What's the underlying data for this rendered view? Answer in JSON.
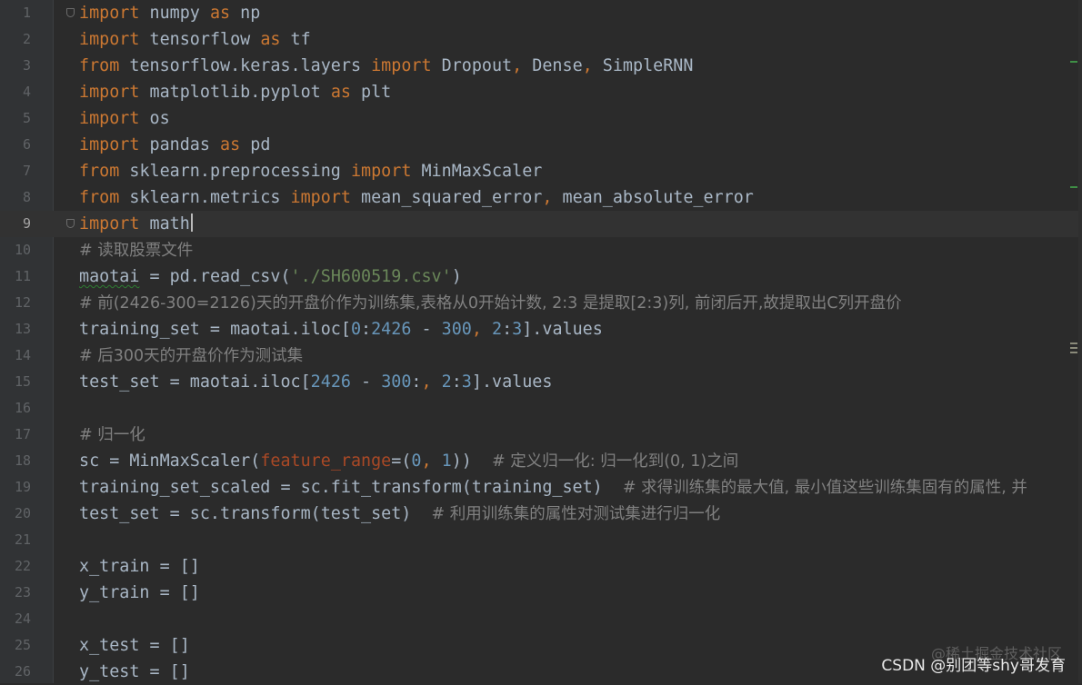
{
  "editor": {
    "language": "python",
    "current_line": 9,
    "theme_colors": {
      "background": "#2b2b2b",
      "gutter": "#313335",
      "keyword": "#cc7832",
      "comment": "#808080",
      "string": "#6a8759",
      "number": "#6897bb",
      "text": "#a9b7c6",
      "param": "#aa4926"
    },
    "lines": [
      {
        "n": "1",
        "t": [
          [
            "kw",
            "import"
          ],
          [
            "",
            " numpy "
          ],
          [
            "kw",
            "as"
          ],
          [
            "",
            " np"
          ]
        ]
      },
      {
        "n": "2",
        "t": [
          [
            "kw",
            "import"
          ],
          [
            "",
            " tensorflow "
          ],
          [
            "kw",
            "as"
          ],
          [
            "",
            " tf"
          ]
        ]
      },
      {
        "n": "3",
        "t": [
          [
            "kw",
            "from"
          ],
          [
            "",
            " tensorflow.keras.layers "
          ],
          [
            "kw",
            "import"
          ],
          [
            "",
            " Dropout"
          ],
          [
            "kw",
            ","
          ],
          [
            "",
            " Dense"
          ],
          [
            "kw",
            ","
          ],
          [
            "",
            " SimpleRNN"
          ]
        ]
      },
      {
        "n": "4",
        "t": [
          [
            "kw",
            "import"
          ],
          [
            "",
            " matplotlib.pyplot "
          ],
          [
            "kw",
            "as"
          ],
          [
            "",
            " plt"
          ]
        ]
      },
      {
        "n": "5",
        "t": [
          [
            "kw",
            "import"
          ],
          [
            "",
            " os"
          ]
        ]
      },
      {
        "n": "6",
        "t": [
          [
            "kw",
            "import"
          ],
          [
            "",
            " pandas "
          ],
          [
            "kw",
            "as"
          ],
          [
            "",
            " pd"
          ]
        ]
      },
      {
        "n": "7",
        "t": [
          [
            "kw",
            "from"
          ],
          [
            "",
            " sklearn.preprocessing "
          ],
          [
            "kw",
            "import"
          ],
          [
            "",
            " MinMaxScaler"
          ]
        ]
      },
      {
        "n": "8",
        "t": [
          [
            "kw",
            "from"
          ],
          [
            "",
            " sklearn.metrics "
          ],
          [
            "kw",
            "import"
          ],
          [
            "",
            " mean_squared_error"
          ],
          [
            "kw",
            ","
          ],
          [
            "",
            " mean_absolute_error"
          ]
        ]
      },
      {
        "n": "9",
        "t": [
          [
            "kw",
            "import"
          ],
          [
            "",
            " math"
          ]
        ]
      },
      {
        "n": "10",
        "t": [
          [
            "cm",
            "# 读取股票文件"
          ]
        ]
      },
      {
        "n": "11",
        "t": [
          [
            "wavy",
            "maotai"
          ],
          [
            "",
            " = pd.read_csv("
          ],
          [
            "str",
            "'./SH600519.csv'"
          ],
          [
            "",
            ")"
          ]
        ]
      },
      {
        "n": "12",
        "t": [
          [
            "cm",
            "# 前(2426-300=2126)天的开盘价作为训练集,表格从0开始计数, 2:3 是提取[2:3)列, 前闭后开,故提取出C列开盘价"
          ]
        ]
      },
      {
        "n": "13",
        "t": [
          [
            "",
            "training_set = maotai.iloc["
          ],
          [
            "num",
            "0"
          ],
          [
            "",
            ":"
          ],
          [
            "num",
            "2426"
          ],
          [
            "",
            " - "
          ],
          [
            "num",
            "300"
          ],
          [
            "kw",
            ","
          ],
          [
            "",
            " "
          ],
          [
            "num",
            "2"
          ],
          [
            "",
            ":"
          ],
          [
            "num",
            "3"
          ],
          [
            "",
            "].values"
          ]
        ]
      },
      {
        "n": "14",
        "t": [
          [
            "cm",
            "# 后300天的开盘价作为测试集"
          ]
        ]
      },
      {
        "n": "15",
        "t": [
          [
            "",
            "test_set = maotai.iloc["
          ],
          [
            "num",
            "2426"
          ],
          [
            "",
            " - "
          ],
          [
            "num",
            "300"
          ],
          [
            "",
            ":"
          ],
          [
            "kw",
            ","
          ],
          [
            "",
            " "
          ],
          [
            "num",
            "2"
          ],
          [
            "",
            ":"
          ],
          [
            "num",
            "3"
          ],
          [
            "",
            "].values"
          ]
        ]
      },
      {
        "n": "16",
        "t": []
      },
      {
        "n": "17",
        "t": [
          [
            "cm",
            "# 归一化"
          ]
        ]
      },
      {
        "n": "18",
        "t": [
          [
            "",
            "sc = MinMaxScaler("
          ],
          [
            "param",
            "feature_range"
          ],
          [
            "",
            "=("
          ],
          [
            "num",
            "0"
          ],
          [
            "kw",
            ","
          ],
          [
            "",
            " "
          ],
          [
            "num",
            "1"
          ],
          [
            "",
            "))  "
          ],
          [
            "cm",
            "# 定义归一化: 归一化到(0, 1)之间"
          ]
        ]
      },
      {
        "n": "19",
        "t": [
          [
            "",
            "training_set_scaled = sc.fit_transform(training_set)  "
          ],
          [
            "cm",
            "# 求得训练集的最大值, 最小值这些训练集固有的属性, 并"
          ]
        ]
      },
      {
        "n": "20",
        "t": [
          [
            "",
            "test_set = sc.transform(test_set)  "
          ],
          [
            "cm",
            "# 利用训练集的属性对测试集进行归一化"
          ]
        ]
      },
      {
        "n": "21",
        "t": []
      },
      {
        "n": "22",
        "t": [
          [
            "",
            "x_train = []"
          ]
        ]
      },
      {
        "n": "23",
        "t": [
          [
            "",
            "y_train = []"
          ]
        ]
      },
      {
        "n": "24",
        "t": []
      },
      {
        "n": "25",
        "t": [
          [
            "",
            "x_test = []"
          ]
        ]
      },
      {
        "n": "26",
        "t": [
          [
            "",
            "y_test = []"
          ]
        ]
      }
    ]
  },
  "watermark": {
    "primary": "CSDN @别团等shy哥发育",
    "secondary": "@稀土掘金技术社区"
  }
}
